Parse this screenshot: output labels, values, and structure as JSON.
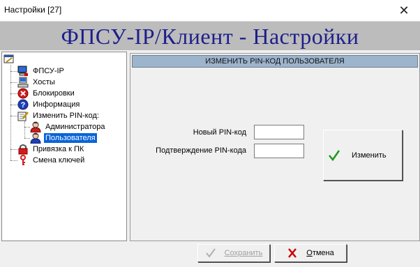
{
  "window": {
    "title": "Настройки [27]",
    "close_glyph": "✕"
  },
  "header": {
    "title": "ФПСУ-IP/Клиент - Настройки"
  },
  "tree": {
    "items": [
      {
        "label": "ФПСУ-IP",
        "icon": "computer-icon"
      },
      {
        "label": "Хосты",
        "icon": "hosts-icon"
      },
      {
        "label": "Блокировки",
        "icon": "blocked-icon"
      },
      {
        "label": "Информация",
        "icon": "info-icon"
      },
      {
        "label": "Изменить PIN-код:",
        "icon": "edit-pin-icon"
      },
      {
        "label": "Администратора",
        "icon": "admin-user-icon"
      },
      {
        "label": "Пользователя",
        "icon": "user-icon",
        "selected": true
      },
      {
        "label": "Привязка к ПК",
        "icon": "lock-icon"
      },
      {
        "label": "Смена ключей",
        "icon": "key-icon"
      }
    ]
  },
  "panel": {
    "heading": "ИЗМЕНИТЬ PIN-КОД ПОЛЬЗОВАТЕЛЯ",
    "new_pin_label": "Новый PIN-код",
    "new_pin_value": "",
    "confirm_pin_label": "Подтверждение PIN-кода",
    "confirm_pin_value": "",
    "change_button": "Изменить"
  },
  "footer": {
    "save_label": "Сохранить",
    "save_enabled": false,
    "cancel_label_first": "О",
    "cancel_label_rest": "тмена"
  },
  "colors": {
    "header_text": "#1e1e8c",
    "section_header_bg": "#9cb4cc",
    "selection": "#0a64d8",
    "check_green": "#1a9a1a",
    "cancel_red": "#cc0000"
  }
}
